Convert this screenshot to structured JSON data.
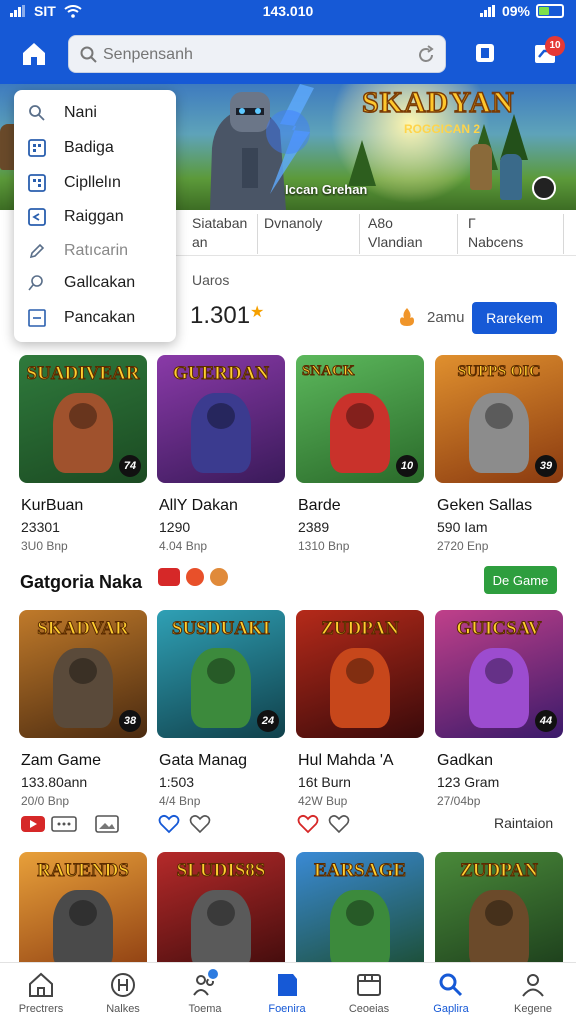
{
  "status": {
    "carrier": "SIT",
    "time": "143.010",
    "battery": "09%"
  },
  "search": {
    "placeholder": "Senpensanh"
  },
  "notif_count": "10",
  "hero": {
    "title": "SKADYAN",
    "subtitle": "ROGGICAN 2",
    "caption": "Iccan Grehan"
  },
  "menu": [
    {
      "label": "Nani",
      "icon": "search-icon"
    },
    {
      "label": "Badiga",
      "icon": "grid-icon"
    },
    {
      "label": "Cipllelın",
      "icon": "grid-icon"
    },
    {
      "label": "Raiggan",
      "icon": "play-icon"
    },
    {
      "label": "Ratıcarin",
      "icon": "pen-icon"
    },
    {
      "label": "Gallcakan",
      "icon": "search-icon"
    },
    {
      "label": "Pancakan",
      "icon": "minus-box-icon"
    }
  ],
  "filters": [
    {
      "l1": "Siataban",
      "l2": "an"
    },
    {
      "l1": "Dvnanoly",
      "l2": ""
    },
    {
      "l1": "A8o",
      "l2": "Vlandian"
    },
    {
      "l1": "Γ",
      "l2": "Nabcens"
    }
  ],
  "stats": {
    "label": "Uaros",
    "value": "1.301",
    "coins": "2amu",
    "redeem": "Rarekem"
  },
  "row1": [
    {
      "logo": "SUADIVEAR",
      "badge": "74",
      "name": "KurBuan",
      "num": "23301",
      "meta": "3U0 Bnp",
      "bg": "#2f7a3c",
      "mon": "#a0522d"
    },
    {
      "logo": "GUERDAN",
      "badge": "",
      "name": "AllY Dakan",
      "num": "1290",
      "meta": "4.04 Bnp",
      "bg": "#6b2f8f",
      "mon": "#3b3b8f"
    },
    {
      "logo": "SNACK",
      "badge": "10",
      "name": "Barde",
      "num": "2389",
      "meta": "1310 Bnp",
      "bg": "#3e9a4a",
      "mon": "#c9322b"
    },
    {
      "logo": "SUPPS OIC",
      "badge": "39",
      "name": "Geken Sallas",
      "num": "590 Iam",
      "meta": "2720 Enp",
      "bg": "#b5641e",
      "mon": "#8c8c8c"
    }
  ],
  "section": {
    "title": "Gatgoria Naka",
    "button": "De Game"
  },
  "row2": [
    {
      "logo": "SKADVAR",
      "badge": "38",
      "name": "Zam Game",
      "num": "133.80ann",
      "meta": "20/0 Bnp",
      "bg": "#8a4f1c",
      "mon": "#5a4a3a"
    },
    {
      "logo": "SUSDUAKI",
      "badge": "24",
      "name": "Gata Manag",
      "num": "1:503",
      "meta": "4/4 Bnp",
      "bg": "#1f6b7a",
      "mon": "#3c8a3c"
    },
    {
      "logo": "ZUDPAN",
      "badge": "",
      "name": "Hul Mahda 'A",
      "num": "16t Burn",
      "meta": "42W Bup",
      "bg": "#7a1f1f",
      "mon": "#c7471b"
    },
    {
      "logo": "GUICSAV",
      "badge": "44",
      "name": "Gadkan",
      "num": "123 Gram",
      "meta": "27/04bp",
      "bg": "#5b2a8a",
      "mon": "#9c4ccf"
    }
  ],
  "rain": "Raintaion",
  "row3": [
    {
      "logo": "RAUENDS",
      "bg": "#d9731e",
      "mon": "#4a4a4a"
    },
    {
      "logo": "SLUDIS8S",
      "bg": "#7a1f1f",
      "mon": "#5a5a5a"
    },
    {
      "logo": "EARSAGE",
      "bg": "#2f6fb5",
      "mon": "#3c8a3c"
    },
    {
      "logo": "ZUDPAN",
      "bg": "#2f5a2a",
      "mon": "#6b4a2a"
    }
  ],
  "nav": [
    {
      "label": "Prectrers",
      "icon": "home-icon"
    },
    {
      "label": "Nalkes",
      "icon": "h-circle-icon"
    },
    {
      "label": "Toema",
      "icon": "people-icon"
    },
    {
      "label": "Foenira",
      "icon": "flag-icon"
    },
    {
      "label": "Ceoeias",
      "icon": "film-icon"
    },
    {
      "label": "Gaplira",
      "icon": "search-icon"
    },
    {
      "label": "Kegene",
      "icon": "profile-icon"
    }
  ],
  "colors": {
    "primary": "#1659d6",
    "green": "#2e9e3e",
    "badge_red": "#e53935"
  }
}
